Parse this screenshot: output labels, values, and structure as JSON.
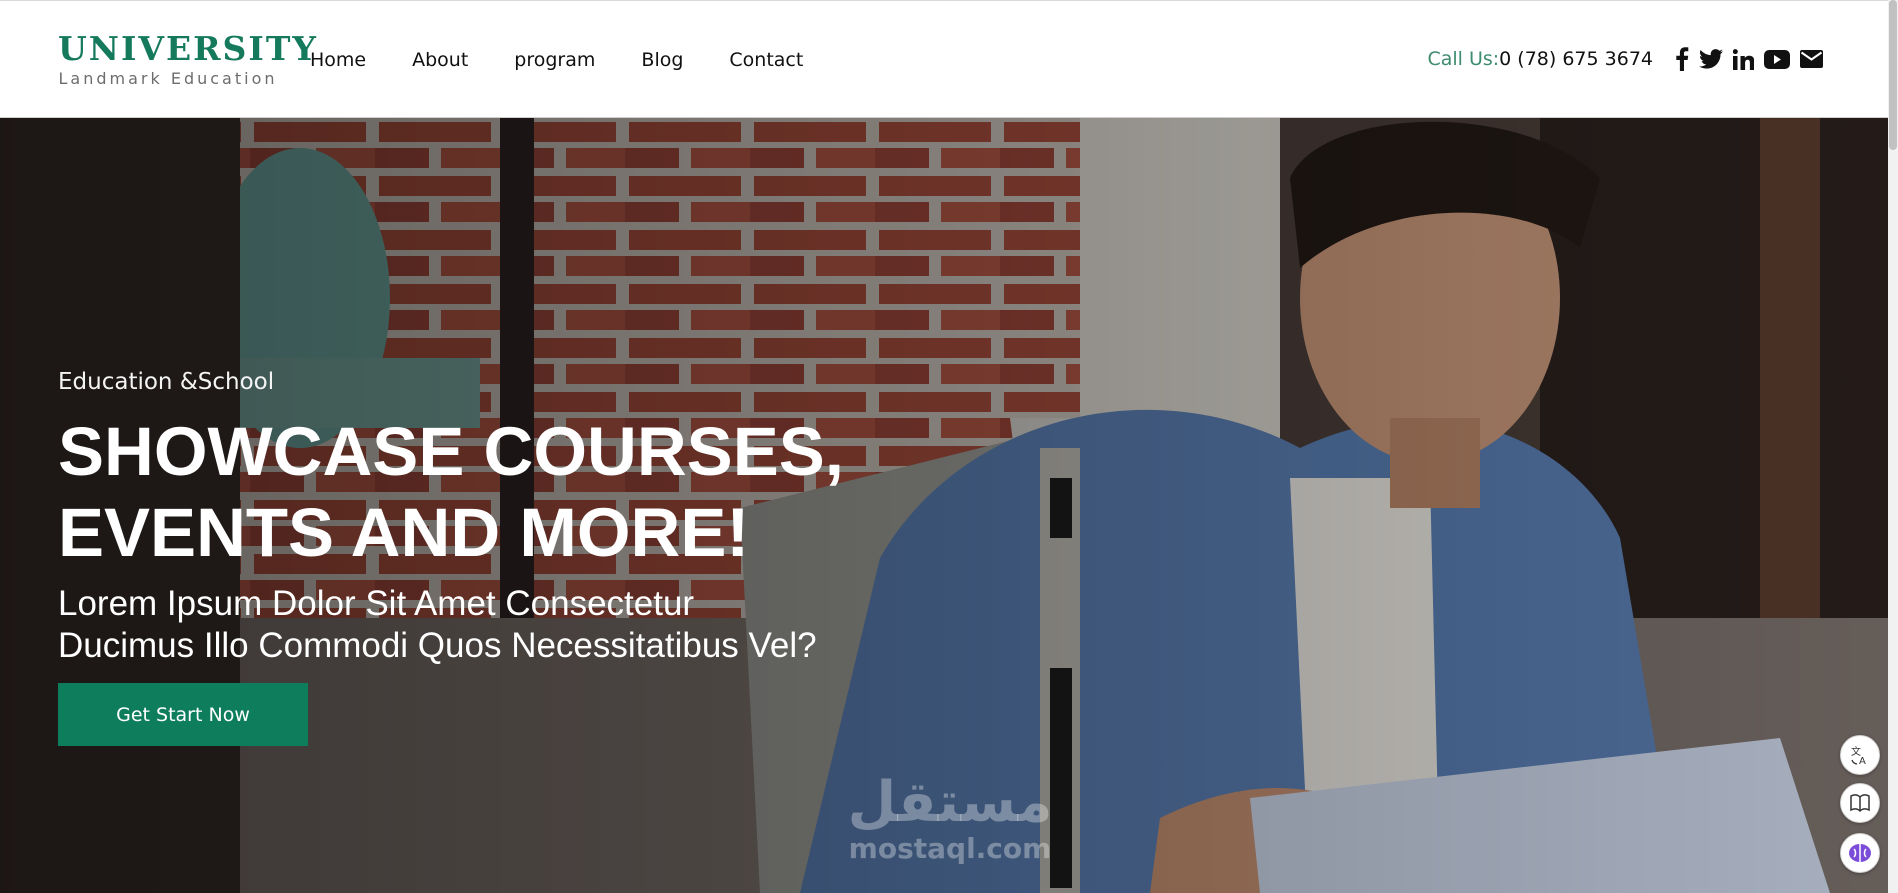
{
  "brand": {
    "title": "UNIVERSITY",
    "subtitle": "Landmark Education",
    "accent_color": "#157a5c"
  },
  "nav": {
    "items": [
      "Home",
      "About",
      "program",
      "Blog",
      "Contact"
    ]
  },
  "contact": {
    "call_label": "Call Us:",
    "phone": "0 (78) 675 3674",
    "social_icons": [
      "facebook-icon",
      "twitter-icon",
      "linkedin-icon",
      "youtube-icon",
      "email-icon"
    ]
  },
  "hero": {
    "tagline": "Education &School",
    "title_line1": "SHOWCASE COURSES,",
    "title_line2": "EVENTS AND MORE!",
    "subtitle_line1": "Lorem Ipsum Dolor Sit Amet Consectetur",
    "subtitle_line2": "Ducimus Illo Commodi Quos Necessitatibus Vel?",
    "cta_label": "Get Start Now",
    "cta_color": "#0e7d5c",
    "background": "photo-student-with-backpack"
  },
  "watermark": {
    "arabic": "مستقل",
    "latin": "mostaql.com"
  },
  "side_buttons": [
    "translate-icon",
    "reader-icon",
    "ai-brain-icon"
  ]
}
